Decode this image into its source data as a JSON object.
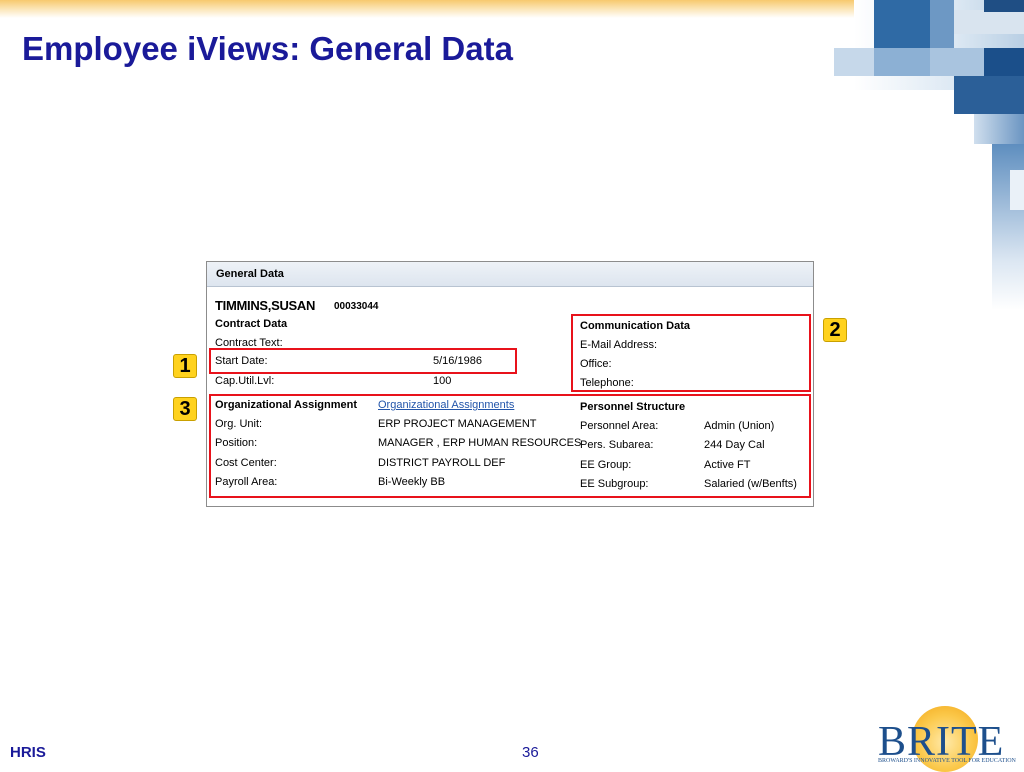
{
  "slide": {
    "title": "Employee iViews: General Data",
    "footer_left": "HRIS",
    "page_number": "36"
  },
  "logo": {
    "wordmark": "BRITE",
    "tagline": "BROWARD'S INNOVATIVE TOOL FOR EDUCATION"
  },
  "panel": {
    "header": "General Data",
    "employee_name": "TIMMINS,SUSAN",
    "employee_id": "00033044",
    "contract": {
      "heading": "Contract Data",
      "rows": [
        {
          "label": "Contract Text:",
          "value": ""
        },
        {
          "label": "Start Date:",
          "value": "5/16/1986"
        },
        {
          "label": "Cap.Util.Lvl:",
          "value": "100"
        }
      ]
    },
    "communication": {
      "heading": "Communication Data",
      "rows": [
        {
          "label": "E-Mail Address:",
          "value": ""
        },
        {
          "label": "Office:",
          "value": ""
        },
        {
          "label": "Telephone:",
          "value": ""
        }
      ]
    },
    "org": {
      "heading": "Organizational Assignment",
      "link": "Organizational Assignments",
      "rows": [
        {
          "label": "Org. Unit:",
          "value": "ERP PROJECT MANAGEMENT"
        },
        {
          "label": "Position:",
          "value": "MANAGER , ERP HUMAN RESOURCES"
        },
        {
          "label": "Cost Center:",
          "value": "DISTRICT PAYROLL DEF"
        },
        {
          "label": "Payroll Area:",
          "value": "Bi-Weekly BB"
        }
      ]
    },
    "personnel": {
      "heading": "Personnel Structure",
      "rows": [
        {
          "label": "Personnel Area:",
          "value": "Admin (Union)"
        },
        {
          "label": "Pers. Subarea:",
          "value": "244 Day Cal"
        },
        {
          "label": "EE Group:",
          "value": "Active FT"
        },
        {
          "label": "EE Subgroup:",
          "value": "Salaried (w/Benfts)"
        }
      ]
    }
  },
  "callouts": [
    "1",
    "2",
    "3"
  ],
  "colors": {
    "title": "#1a1a99",
    "highlight_box": "#e8121b",
    "callout_fill": "#ffd21e",
    "link": "#2255aa",
    "logo_blue": "#1d4f8c"
  }
}
